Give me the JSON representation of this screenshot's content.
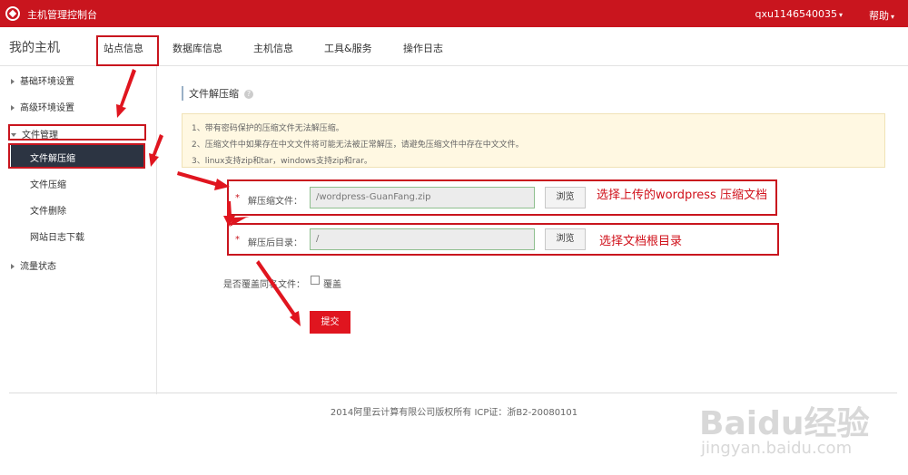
{
  "topbar": {
    "console_title": "主机管理控制台",
    "user": "qxu1146540035",
    "help": "帮助",
    "caret": "▾"
  },
  "subnav": {
    "my_host": "我的主机",
    "tabs": [
      {
        "label": "站点信息"
      },
      {
        "label": "数据库信息"
      },
      {
        "label": "主机信息"
      },
      {
        "label": "工具&服务"
      },
      {
        "label": "操作日志"
      }
    ]
  },
  "sidebar": {
    "groups": [
      {
        "label": "基础环境设置"
      },
      {
        "label": "高级环境设置"
      },
      {
        "label": "文件管理"
      },
      {
        "label": "流量状态"
      }
    ],
    "file_items": [
      {
        "label": "文件解压缩"
      },
      {
        "label": "文件压缩"
      },
      {
        "label": "文件删除"
      },
      {
        "label": "网站日志下载"
      }
    ]
  },
  "content": {
    "title": "文件解压缩",
    "help_icon": "?",
    "notices": [
      "1、带有密码保护的压缩文件无法解压缩。",
      "2、压缩文件中如果存在中文文件将可能无法被正常解压，请避免压缩文件中存在中文文件。",
      "3、linux支持zip和tar，windows支持zip和rar。"
    ],
    "form": {
      "required_mark": "*",
      "archive_label": "解压缩文件：",
      "archive_value": "/wordpress-GuanFang.zip",
      "dest_label": "解压后目录：",
      "dest_value": "/",
      "browse_label": "浏览",
      "overwrite_label": "是否覆盖同名文件：",
      "overwrite_option": "覆盖",
      "submit_label": "提交"
    },
    "annotations": {
      "archive_hint": "选择上传的wordpress 压缩文档",
      "dest_hint": "选择文档根目录"
    }
  },
  "footer": {
    "text": "2014阿里云计算有限公司版权所有 ICP证：浙B2-20080101"
  },
  "watermark": {
    "main": "Baidu经验",
    "sub": "jingyan.baidu.com"
  },
  "colors": {
    "brand_red": "#c9151e",
    "annotation_red": "#d0101a",
    "sidebar_active": "#2c3442",
    "notice_bg": "#fff8e2"
  }
}
